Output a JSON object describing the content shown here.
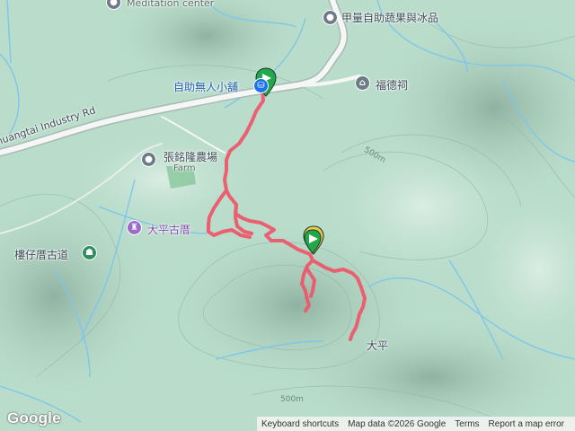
{
  "labels": {
    "meditation": "Meditation center",
    "shop_top": "甲量自助蔬果與冰品",
    "self_store": "自助無人小舖",
    "temple": "福德祠",
    "farm_name": "張銘隆農場",
    "farm_en": "Farm",
    "industry_rd": "huangtai Industry Rd",
    "ancient_temple": "大平古厝",
    "trail": "樓仔厝古道",
    "dapin": "大平",
    "contour_1": "500m",
    "contour_2": "500m"
  },
  "footer": {
    "keyboard": "Keyboard shortcuts",
    "mapdata": "Map data ©2026 Google",
    "terms": "Terms",
    "report": "Report a map error"
  },
  "logo": "Google",
  "colors": {
    "track": "#f0566a",
    "terrain_base": "#b9dccb",
    "road": "#f4f7f6",
    "water": "#7fc6e8",
    "start_marker": "#22a84a",
    "marker_border": "#1b3a2a"
  },
  "icons": {
    "meditation": "place-icon",
    "shop": "place-icon",
    "store": "shopping-icon",
    "temple": "temple-icon",
    "farm": "place-icon",
    "ancient": "historic-icon",
    "trail": "hiking-icon"
  }
}
